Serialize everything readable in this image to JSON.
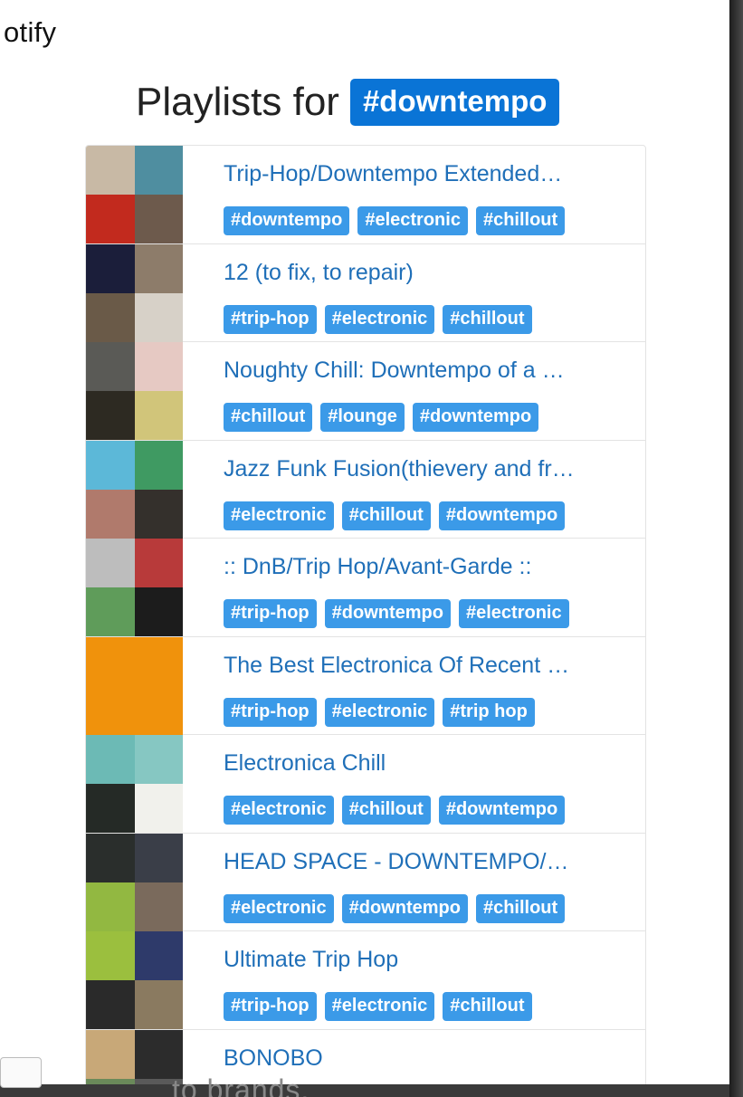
{
  "app": {
    "name": "otify"
  },
  "heading": {
    "text": "Playlists for",
    "tag": "#downtempo"
  },
  "playlists": [
    {
      "title": "Trip-Hop/Downtempo Extended…",
      "tags": [
        "#downtempo",
        "#electronic",
        "#chillout"
      ],
      "cover": [
        "#c8b9a5",
        "#4f8ea0",
        "#c22a1e",
        "#6d5a4c"
      ]
    },
    {
      "title": "12 (to fix, to repair)",
      "tags": [
        "#trip-hop",
        "#electronic",
        "#chillout"
      ],
      "cover": [
        "#1b1e3a",
        "#8d7c6a",
        "#6a5a48",
        "#d7d1c8"
      ]
    },
    {
      "title": "Noughty Chill: Downtempo of a …",
      "tags": [
        "#chillout",
        "#lounge",
        "#downtempo"
      ],
      "cover": [
        "#5a5a56",
        "#e6c9c3",
        "#2d2a22",
        "#d1c57a"
      ]
    },
    {
      "title": "Jazz Funk Fusion(thievery and fr…",
      "tags": [
        "#electronic",
        "#chillout",
        "#downtempo"
      ],
      "cover": [
        "#5cb8d8",
        "#3f9a62",
        "#b07a6c",
        "#34302c"
      ]
    },
    {
      "title": ":: DnB/Trip Hop/Avant-Garde ::",
      "tags": [
        "#trip-hop",
        "#downtempo",
        "#electronic"
      ],
      "cover": [
        "#bdbdbd",
        "#b83a3a",
        "#5f9c5a",
        "#1c1c1c"
      ]
    },
    {
      "title": "The Best Electronica Of Recent …",
      "tags": [
        "#trip-hop",
        "#electronic",
        "#trip hop"
      ],
      "cover": [
        "#f0920c"
      ]
    },
    {
      "title": "Electronica Chill",
      "tags": [
        "#electronic",
        "#chillout",
        "#downtempo"
      ],
      "cover": [
        "#6cbab5",
        "#86c7c2",
        "#252a26",
        "#f1f1ec"
      ]
    },
    {
      "title": "HEAD SPACE - DOWNTEMPO/…",
      "tags": [
        "#electronic",
        "#downtempo",
        "#chillout"
      ],
      "cover": [
        "#2a2e2c",
        "#3a3e48",
        "#92b841",
        "#7a6a5c"
      ]
    },
    {
      "title": "Ultimate Trip Hop",
      "tags": [
        "#trip-hop",
        "#electronic",
        "#chillout"
      ],
      "cover": [
        "#9bbf3e",
        "#2e3a6a",
        "#2a2a2a",
        "#8a7a60"
      ]
    },
    {
      "title": "BONOBO",
      "tags": [],
      "cover": [
        "#c8a878",
        "#2c2c2c",
        "#6a8a5a",
        "#5a5a5a"
      ]
    }
  ],
  "footer": {
    "partial_text": "to brands."
  }
}
